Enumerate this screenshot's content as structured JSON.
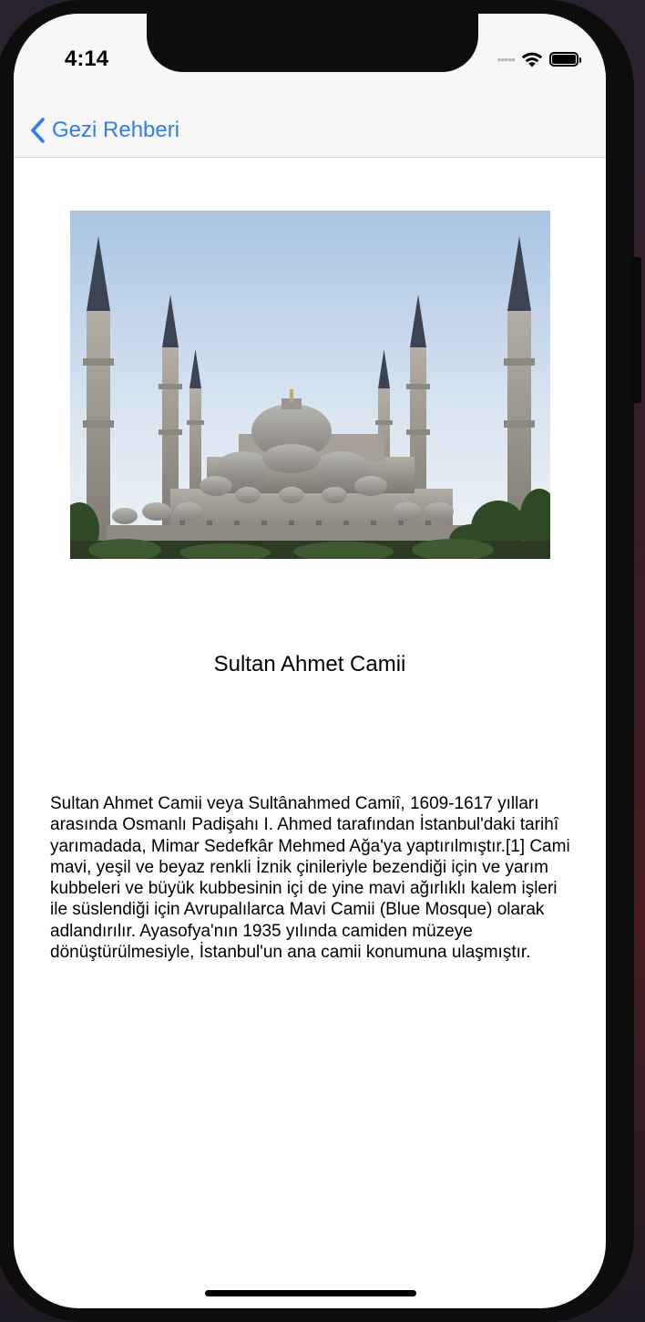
{
  "status_bar": {
    "time": "4:14",
    "signal_icon": "cellular-dots-icon",
    "wifi_icon": "wifi-icon",
    "battery_icon": "battery-icon"
  },
  "nav_bar": {
    "back_icon": "chevron-left-icon",
    "back_label": "Gezi Rehberi",
    "accent_color": "#2f7cf6"
  },
  "detail": {
    "image_subject": "mosque-photo",
    "title": "Sultan Ahmet Camii",
    "description": "Sultan Ahmet Camii veya Sultânahmed Camiî, 1609-1617 yılları arasında Osmanlı Padişahı I. Ahmed tarafından İstanbul'daki tarihî yarımadada, Mimar Sedefkâr Mehmed Ağa'ya yaptırılmıştır.[1] Cami mavi, yeşil ve beyaz renkli İznik çinileriyle bezendiği için ve yarım kubbeleri ve büyük kubbesinin içi de yine mavi ağırlıklı kalem işleri ile süslendiği için Avrupalılarca Mavi Camii (Blue Mosque) olarak adlandırılır. Ayasofya'nın 1935 yılında camiden müzeye dönüştürülmesiyle, İstanbul'un ana camii konumuna ulaşmıştır."
  }
}
